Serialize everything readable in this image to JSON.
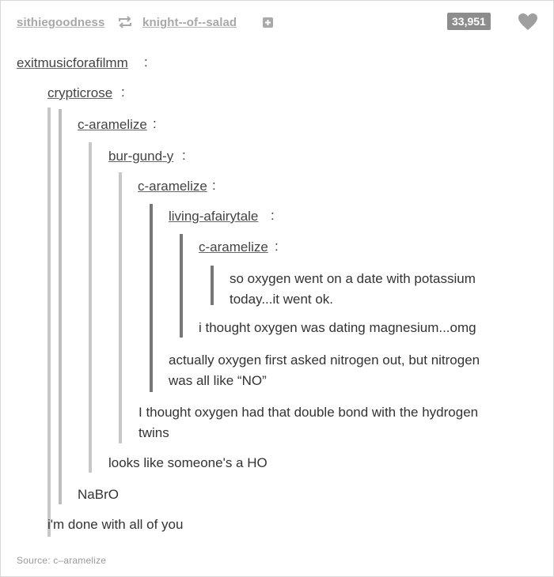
{
  "header": {
    "users": [
      "sithiegoodness",
      "knight--of--salad"
    ],
    "notes": "33,951",
    "icons": [
      "reblog-icon",
      "plus-icon",
      "heart-icon"
    ]
  },
  "thread": {
    "level0": {
      "user": "exitmusicforafilmm",
      "text": "i'm done with all of you"
    },
    "level1": {
      "user": "crypticrose",
      "text": "NaBrO"
    },
    "level2": {
      "user": "c-aramelize",
      "text": "looks like someone's a HO"
    },
    "level3": {
      "user": "bur-gund-y",
      "lines": [
        "I thought oxygen had that double bond with the hydrogen",
        "twins"
      ]
    },
    "level4": {
      "user": "c-aramelize",
      "lines": [
        "actually oxygen first asked nitrogen out, but nitrogen",
        "was all like “NO”"
      ]
    },
    "level5": {
      "user": "living-afairytale",
      "text": "i thought oxygen was dating magnesium...omg"
    },
    "level6": {
      "user": "c-aramelize",
      "lines": [
        "so oxygen went on a date with potassium",
        "today...it went ok."
      ]
    }
  },
  "source": "Source: c–aramelize",
  "colors": {
    "bar": "#c8c8c8",
    "bar_dark": "#777777",
    "accent_grey": "#8d8d8d"
  }
}
